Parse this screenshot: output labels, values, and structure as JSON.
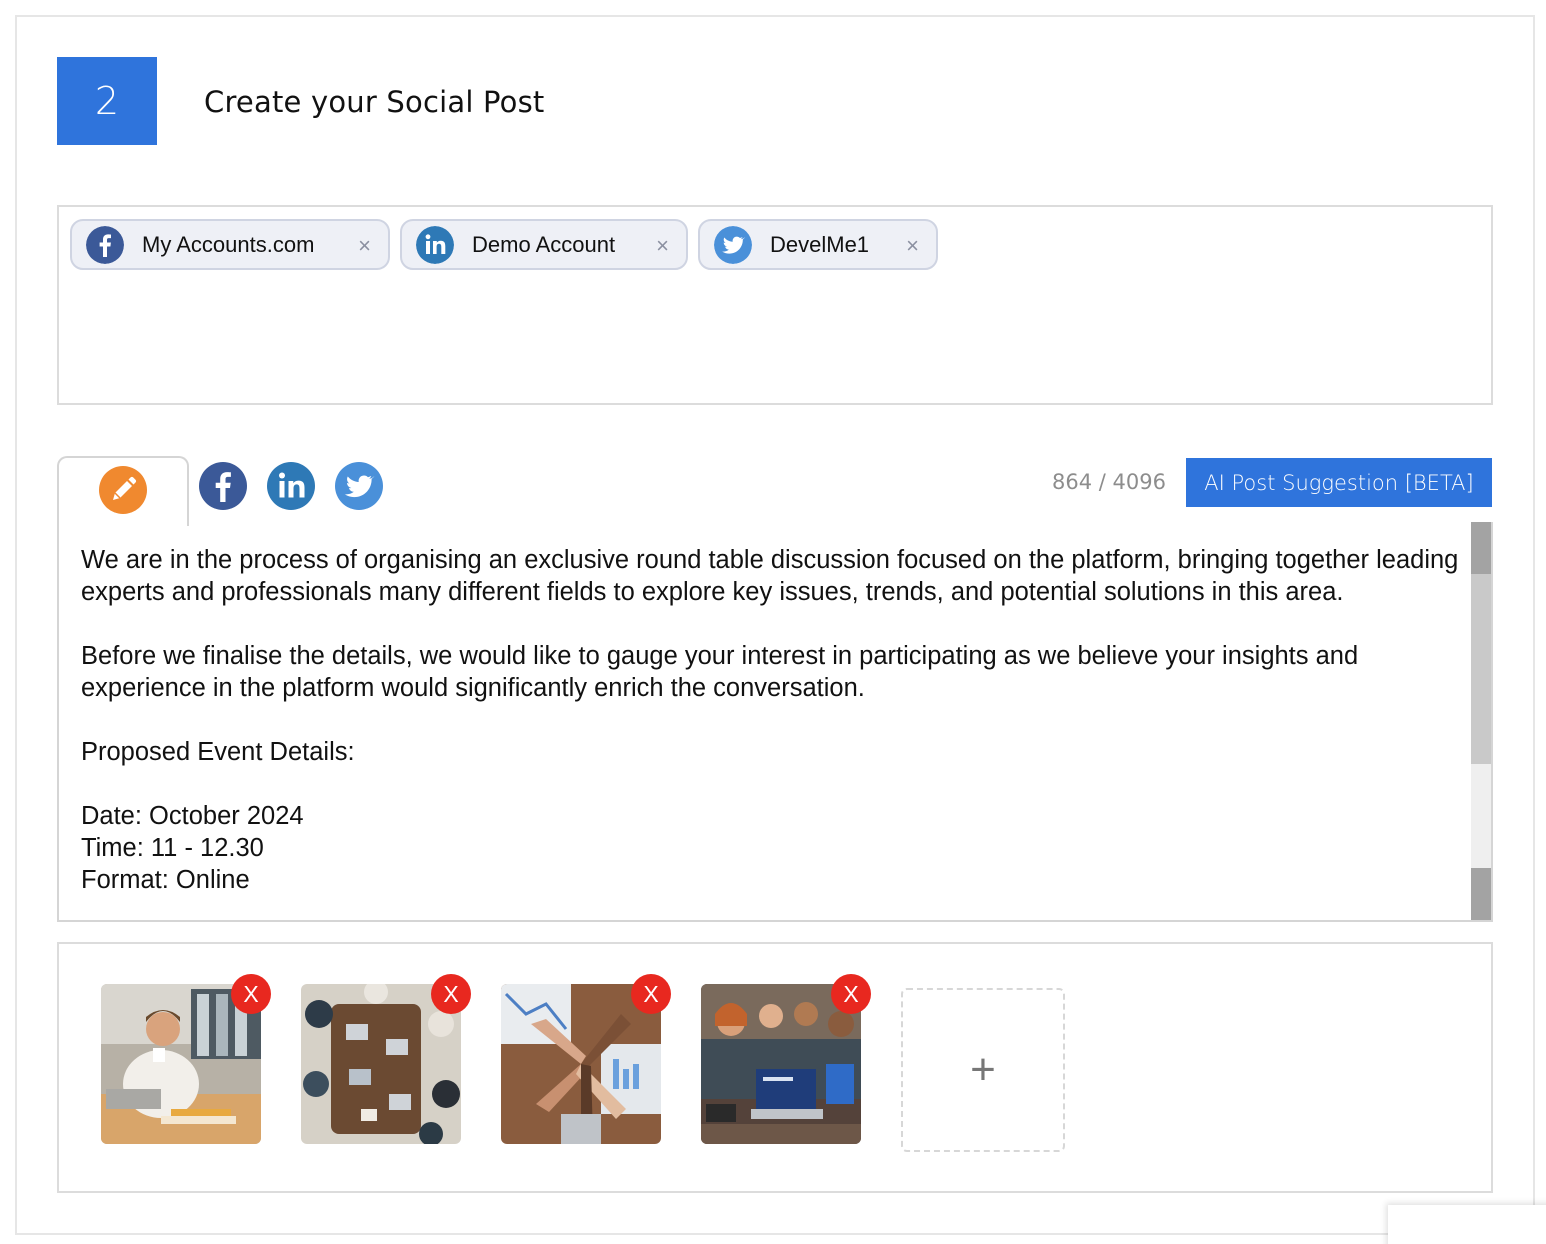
{
  "step": {
    "number": "2",
    "title": "Create your Social Post"
  },
  "accounts": [
    {
      "network": "facebook",
      "icon": "facebook-icon",
      "label": "My Accounts.com",
      "remove": "×"
    },
    {
      "network": "linkedin",
      "icon": "linkedin-icon",
      "label": "Demo Account",
      "remove": "×"
    },
    {
      "network": "twitter",
      "icon": "twitter-icon",
      "label": "DevelMe1",
      "remove": "×"
    }
  ],
  "editor": {
    "tabs": [
      "pencil-icon",
      "facebook-icon",
      "linkedin-icon",
      "twitter-icon"
    ],
    "char_count": "864 / 4096",
    "ai_button": "AI Post Suggestion [BETA]",
    "text": "We are in the process of organising an exclusive round table discussion focused on the platform, bringing together leading experts and professionals many different fields to explore key issues, trends, and potential solutions in this area.\n\nBefore we finalise the details, we would like to gauge your interest in participating as we believe your insights and experience in the platform would significantly enrich the conversation.\n\nProposed Event Details:\n\nDate: October 2024\nTime: 11 - 12.30\nFormat: Online"
  },
  "media": {
    "items": [
      {
        "remove": "X"
      },
      {
        "remove": "X"
      },
      {
        "remove": "X"
      },
      {
        "remove": "X"
      }
    ],
    "add_label": "+"
  },
  "colors": {
    "primary": "#2f74dc",
    "facebook": "#3b5998",
    "linkedin": "#2e79b6",
    "twitter": "#4a90d9",
    "pencil": "#f0892f",
    "remove": "#e8281f"
  }
}
